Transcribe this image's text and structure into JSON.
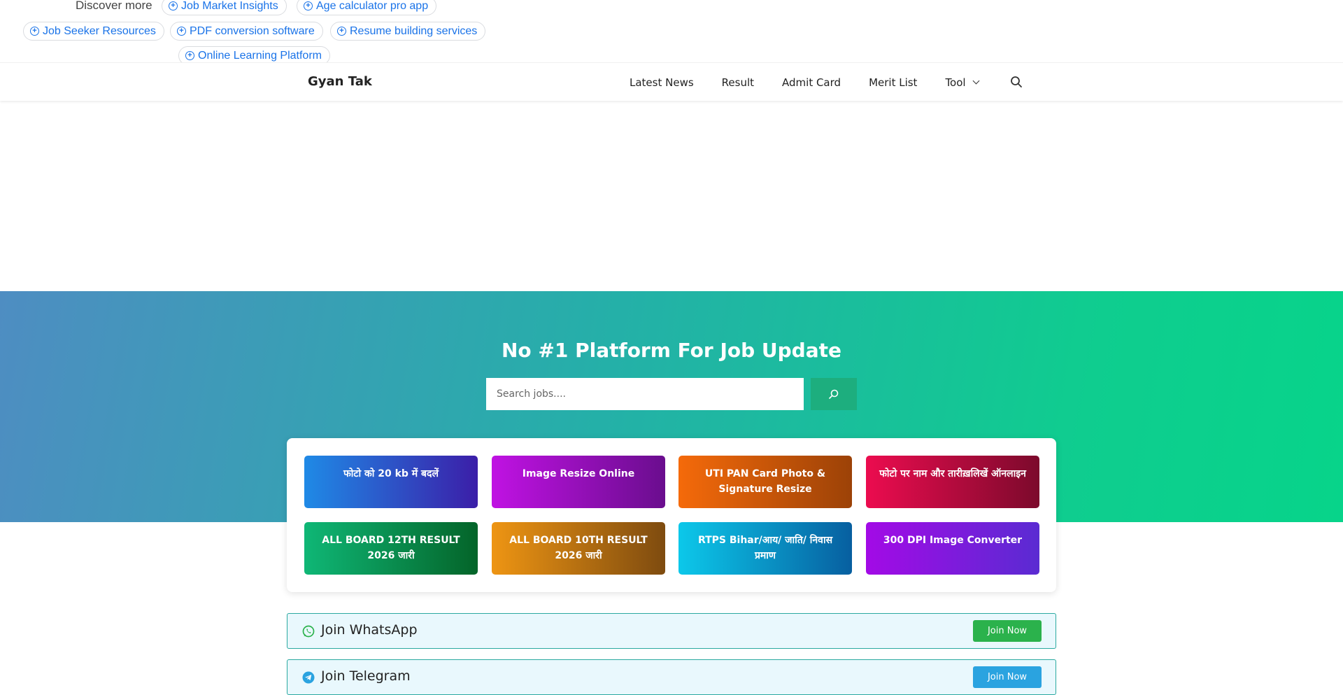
{
  "discover": {
    "label": "Discover more",
    "chips": [
      "Job Market Insights",
      "Age calculator pro app",
      "Job Seeker Resources",
      "PDF conversion software",
      "Resume building services",
      "Online Learning Platform"
    ]
  },
  "header": {
    "brand": "Gyan Tak",
    "nav": [
      "Latest News",
      "Result",
      "Admit Card",
      "Merit List",
      "Tool"
    ]
  },
  "hero": {
    "title": "No #1 Platform For Job Update",
    "search_placeholder": "Search jobs...."
  },
  "tools": [
    "फोटो को 20 kb में बदलें",
    "Image Resize Online",
    "UTI PAN Card Photo & Signature Resize",
    "फोटो पर नाम और तारीख़लिखें ऑनलाइन",
    "ALL BOARD 12TH RESULT 2026 जारी",
    "ALL BOARD 10TH RESULT 2026 जारी",
    "RTPS Bihar/आय/ जाति/ निवास प्रमाण",
    "300 DPI Image Converter"
  ],
  "join": {
    "whatsapp": {
      "label": "Join WhatsApp",
      "button": "Join Now",
      "color": "#2bb24c"
    },
    "telegram": {
      "label": "Join Telegram",
      "button": "Join Now",
      "color": "#2aa3e0"
    }
  }
}
